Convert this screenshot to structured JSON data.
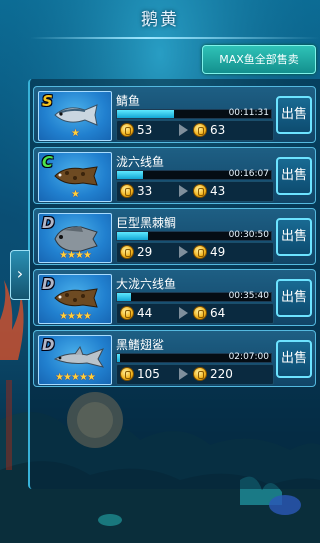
{
  "header": {
    "title": "鹅黄"
  },
  "max_sell_button": "MAX鱼全部售卖",
  "side_tab_icon": "chevron-right-icon",
  "sell_label": "出售",
  "fish": [
    {
      "rank": "S",
      "rank_color": "#f2c21f",
      "name": "鲭鱼",
      "stars": "★",
      "progress": 0.37,
      "time": "00:11:31",
      "price_now": "53",
      "price_max": "63",
      "fish_icon": "mackerel-icon"
    },
    {
      "rank": "C",
      "rank_color": "#4ce34a",
      "name": "泷六线鱼",
      "stars": "★",
      "progress": 0.17,
      "time": "00:16:07",
      "price_now": "33",
      "price_max": "43",
      "fish_icon": "greenling-icon"
    },
    {
      "rank": "D",
      "rank_color": "#b0b6c7",
      "name": "巨型黑棘鲷",
      "stars": "★★★★",
      "progress": 0.2,
      "time": "00:30:50",
      "price_now": "29",
      "price_max": "49",
      "fish_icon": "black-seabream-icon"
    },
    {
      "rank": "D",
      "rank_color": "#b0b6c7",
      "name": "大泷六线鱼",
      "stars": "★★★★",
      "progress": 0.09,
      "time": "00:35:40",
      "price_now": "44",
      "price_max": "64",
      "fish_icon": "greenling-icon"
    },
    {
      "rank": "D",
      "rank_color": "#b0b6c7",
      "name": "黑鳍翅鲨",
      "stars": "★★★★★",
      "progress": 0.02,
      "time": "02:07:00",
      "price_now": "105",
      "price_max": "220",
      "fish_icon": "shark-icon"
    }
  ]
}
